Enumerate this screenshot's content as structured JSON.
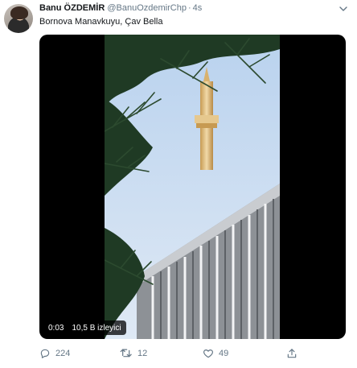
{
  "tweet": {
    "display_name": "Banu ÖZDEMİR",
    "handle": "@BanuOzdemirChp",
    "separator": "·",
    "time": "4s",
    "text": "Bornova Manavkuyu, Çav Bella"
  },
  "video": {
    "elapsed": "0:03",
    "views": "10,5 B izleyici"
  },
  "actions": {
    "reply_count": "224",
    "retweet_count": "12",
    "like_count": "49"
  },
  "colors": {
    "text_primary": "#14171a",
    "text_secondary": "#657786",
    "media_background": "#000000"
  }
}
